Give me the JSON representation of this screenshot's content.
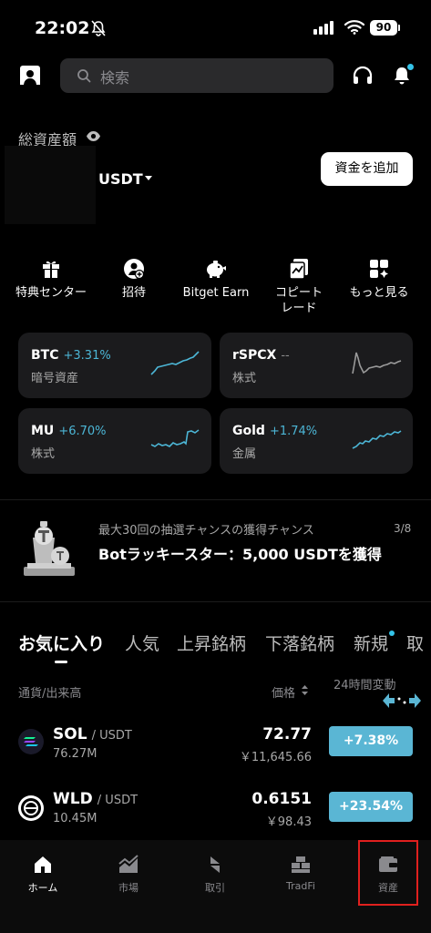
{
  "status_bar": {
    "time": "22:02",
    "battery": "90"
  },
  "search": {
    "placeholder": "検索"
  },
  "assets": {
    "label": "総資産額",
    "currency": "USDT",
    "add_funds": "資金を追加"
  },
  "quick_actions": [
    {
      "label": "特典センター",
      "icon": "gift-icon"
    },
    {
      "label": "招待",
      "icon": "invite-icon"
    },
    {
      "label": "Bitget Earn",
      "icon": "piggy-bank-icon"
    },
    {
      "label": "コピートレード",
      "icon": "copy-trade-icon"
    },
    {
      "label": "もっと見る",
      "icon": "more-grid-icon"
    }
  ],
  "market_cards": [
    {
      "name": "BTC",
      "change": "+3.31%",
      "category": "暗号資産"
    },
    {
      "name": "rSPCX",
      "change": "--",
      "category": "株式"
    },
    {
      "name": "MU",
      "change": "+6.70%",
      "category": "株式"
    },
    {
      "name": "Gold",
      "change": "+1.74%",
      "category": "金属"
    }
  ],
  "promo": {
    "subtitle": "最大30回の抽選チャンスの獲得チャンス",
    "title": "Botラッキースター：5,000 USDTを獲得",
    "page": "3/8"
  },
  "tabs": [
    "お気に入り",
    "人気",
    "上昇銘柄",
    "下落銘柄",
    "新規",
    "取"
  ],
  "list_header": {
    "pair_volume": "通貨/出来高",
    "price": "価格",
    "change_24h": "24時間変動"
  },
  "coins": [
    {
      "symbol": "SOL",
      "pair": "/ USDT",
      "volume": "76.27M",
      "price": "72.77",
      "price_jpy": "￥11,645.66",
      "change": "+7.38%"
    },
    {
      "symbol": "WLD",
      "pair": "/ USDT",
      "volume": "10.45M",
      "price": "0.6151",
      "price_jpy": "￥98.43",
      "change": "+23.54%"
    }
  ],
  "bottom_nav": [
    {
      "label": "ホーム",
      "icon": "home-icon"
    },
    {
      "label": "市場",
      "icon": "market-chart-icon"
    },
    {
      "label": "取引",
      "icon": "trade-icon"
    },
    {
      "label": "TradFi",
      "icon": "tradfi-icon"
    },
    {
      "label": "資産",
      "icon": "wallet-icon"
    }
  ],
  "colors": {
    "accent": "#4cb6d6",
    "up_button": "#5ab6d4",
    "highlight": "#e0201e"
  }
}
